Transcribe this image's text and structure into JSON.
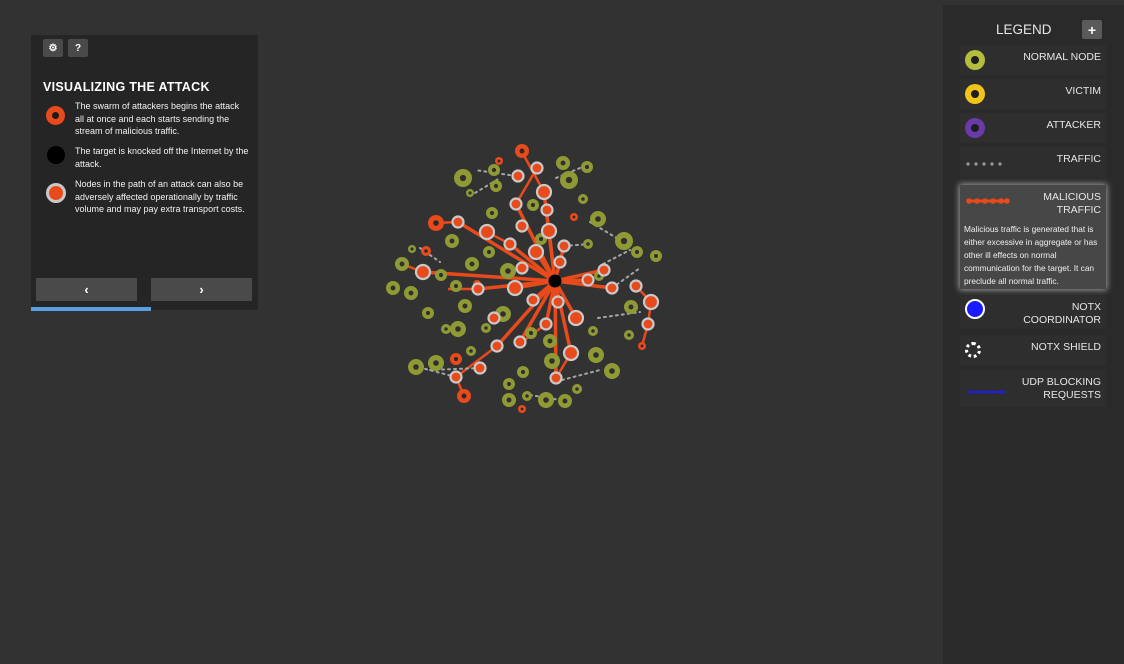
{
  "info_panel": {
    "title": "VISUALIZING THE ATTACK",
    "settings_icon": "⚙",
    "help_icon": "?",
    "items": [
      {
        "text": "The swarm of attackers begins the attack all at once and each starts sending the stream of malicious traffic.",
        "icon": "attacker-dot-icon"
      },
      {
        "text": "The target is knocked off the Internet by the attack.",
        "icon": "target-dot-icon"
      },
      {
        "text": "Nodes in the path of an attack can also be adversely affected operationally by traffic volume and may pay extra transport costs.",
        "icon": "affected-node-icon"
      }
    ],
    "prev_label": "‹",
    "next_label": "›",
    "progress_percent": 53
  },
  "legend": {
    "title": "LEGEND",
    "add_label": "+",
    "items": [
      {
        "label": "NORMAL NODE",
        "icon": "normal-node-icon",
        "color": "#b5bd3c"
      },
      {
        "label": "VICTIM",
        "icon": "victim-icon",
        "color": "#f0c419"
      },
      {
        "label": "ATTACKER",
        "icon": "attacker-icon",
        "color": "#6a3aa8"
      },
      {
        "label": "TRAFFIC",
        "icon": "traffic-icon",
        "color": "#9a9a9a"
      },
      {
        "label": "MALICIOUS\nTRAFFIC",
        "icon": "malicious-traffic-icon",
        "color": "#e84a1c",
        "description": "Malicious traffic is generated that is either excessive in aggregate or has other ill effects on normal communication for the target. It can preclude all normal traffic."
      },
      {
        "label": "NOTX\nCOORDINATOR",
        "icon": "notx-coordinator-icon",
        "color": "#1a1aff"
      },
      {
        "label": "NOTX SHIELD",
        "icon": "notx-shield-icon",
        "color": "#ffffff"
      },
      {
        "label": "UDP BLOCKING\nREQUESTS",
        "icon": "udp-blocking-icon",
        "color": "#1a1aff"
      }
    ]
  },
  "colors": {
    "normal": "#8f9a35",
    "normal_inner": "#b9c33f",
    "malicious": "#e84a1c",
    "affected_ring": "#c9c9c9",
    "target": "#000000"
  }
}
